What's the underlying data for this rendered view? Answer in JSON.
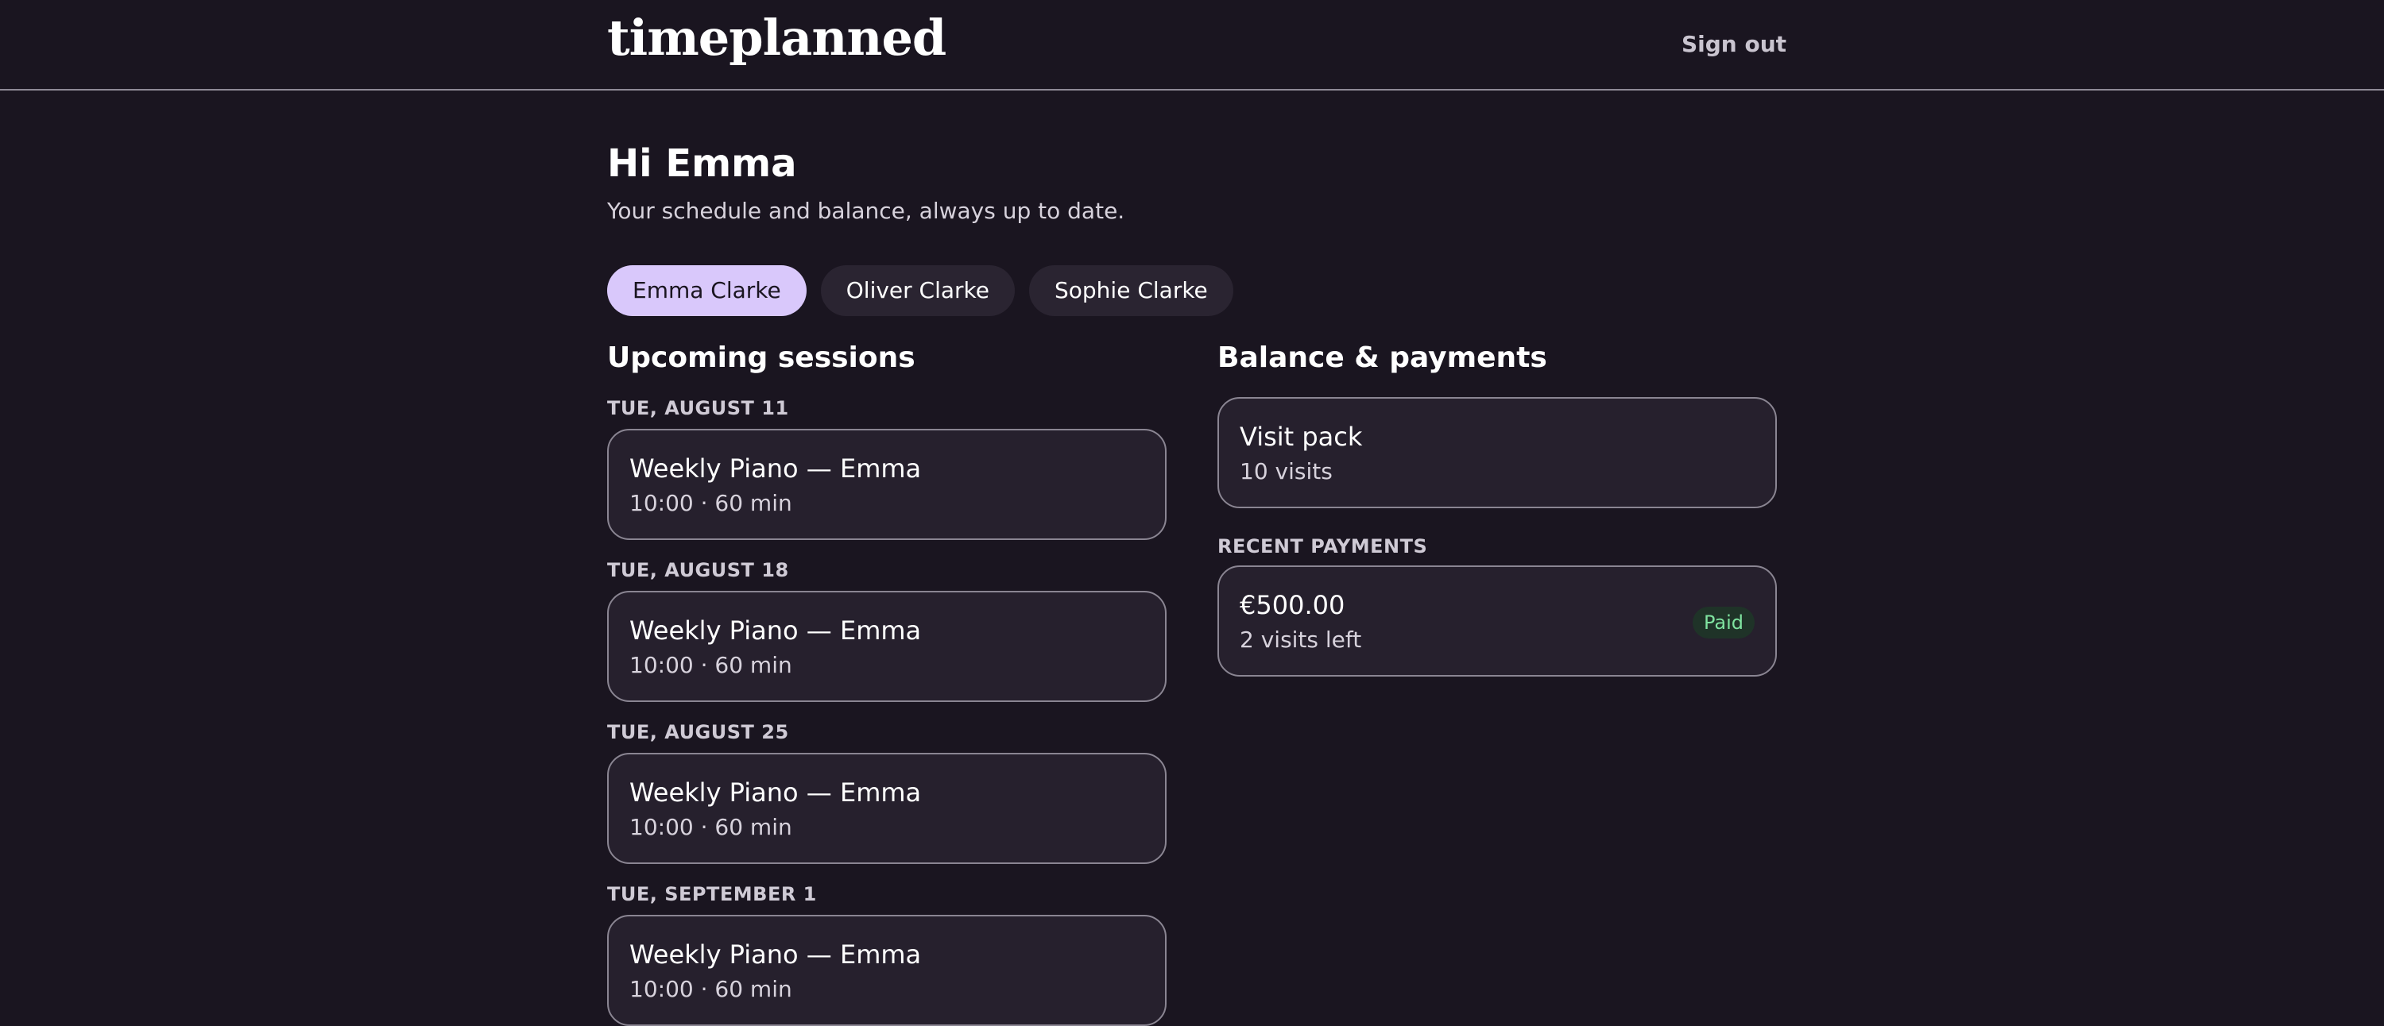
{
  "header": {
    "logo": "timeplanned",
    "sign_out_label": "Sign out"
  },
  "greeting": {
    "title": "Hi Emma",
    "subtitle": "Your schedule and balance, always up to date."
  },
  "students": [
    {
      "name": "Emma Clarke",
      "active": true
    },
    {
      "name": "Oliver Clarke",
      "active": false
    },
    {
      "name": "Sophie Clarke",
      "active": false
    }
  ],
  "upcoming": {
    "title": "Upcoming sessions",
    "sessions": [
      {
        "date": "TUE, AUGUST 11",
        "title": "Weekly Piano — Emma",
        "details": "10:00 · 60 min"
      },
      {
        "date": "TUE, AUGUST 18",
        "title": "Weekly Piano — Emma",
        "details": "10:00 · 60 min"
      },
      {
        "date": "TUE, AUGUST 25",
        "title": "Weekly Piano — Emma",
        "details": "10:00 · 60 min"
      },
      {
        "date": "TUE, SEPTEMBER 1",
        "title": "Weekly Piano — Emma",
        "details": "10:00 · 60 min"
      }
    ]
  },
  "balance": {
    "title": "Balance & payments",
    "pack": {
      "name": "Visit pack",
      "details": "10 visits"
    },
    "recent_payments_label": "RECENT PAYMENTS",
    "payments": [
      {
        "amount": "€500.00",
        "details": "2 visits left",
        "status": "Paid"
      }
    ]
  },
  "colors": {
    "background": "#1a1520",
    "active_tab": "#d9c8fb",
    "card": "#26202d",
    "paid_badge": "#7fe3a0"
  }
}
